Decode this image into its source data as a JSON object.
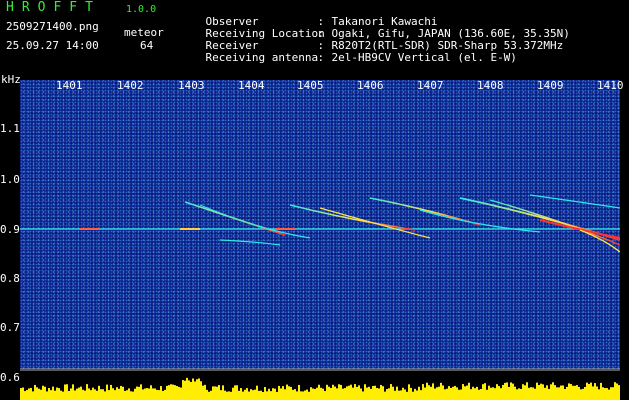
{
  "header": {
    "app_title": "HROFFT",
    "version": "1.0.0",
    "filename": "2509271400.png",
    "meteor_label": "meteor",
    "datetime": "25.09.27 14:00",
    "meteor_count": "64"
  },
  "info": [
    {
      "label": "Observer",
      "sep": ":",
      "value": "Takanori Kawachi"
    },
    {
      "label": "Receiving Location",
      "sep": ":",
      "value": "Ogaki, Gifu, JAPAN (136.60E, 35.35N)"
    },
    {
      "label": "Receiver",
      "sep": ":",
      "value": "R820T2(RTL-SDR) SDR-Sharp 53.372MHz"
    },
    {
      "label": "Receiving antenna",
      "sep": ":",
      "value": "2el-HB9CV Vertical (el. E-W)"
    }
  ],
  "axis": {
    "y_unit": "kHz",
    "y_ticks": [
      "1.1",
      "1.0",
      "0.9",
      "0.8",
      "0.7",
      "0.6"
    ],
    "x_ticks": [
      "1401",
      "1402",
      "1403",
      "1404",
      "1405",
      "1406",
      "1407",
      "1408",
      "1409",
      "1410"
    ]
  },
  "colors": {
    "background": "#0a1f8c",
    "title": "#33ee33",
    "signal_low": "#2ee8e8",
    "signal_high": "#ff3030",
    "level_bar": "#ffee00",
    "level_base": "#00c8ff"
  }
}
